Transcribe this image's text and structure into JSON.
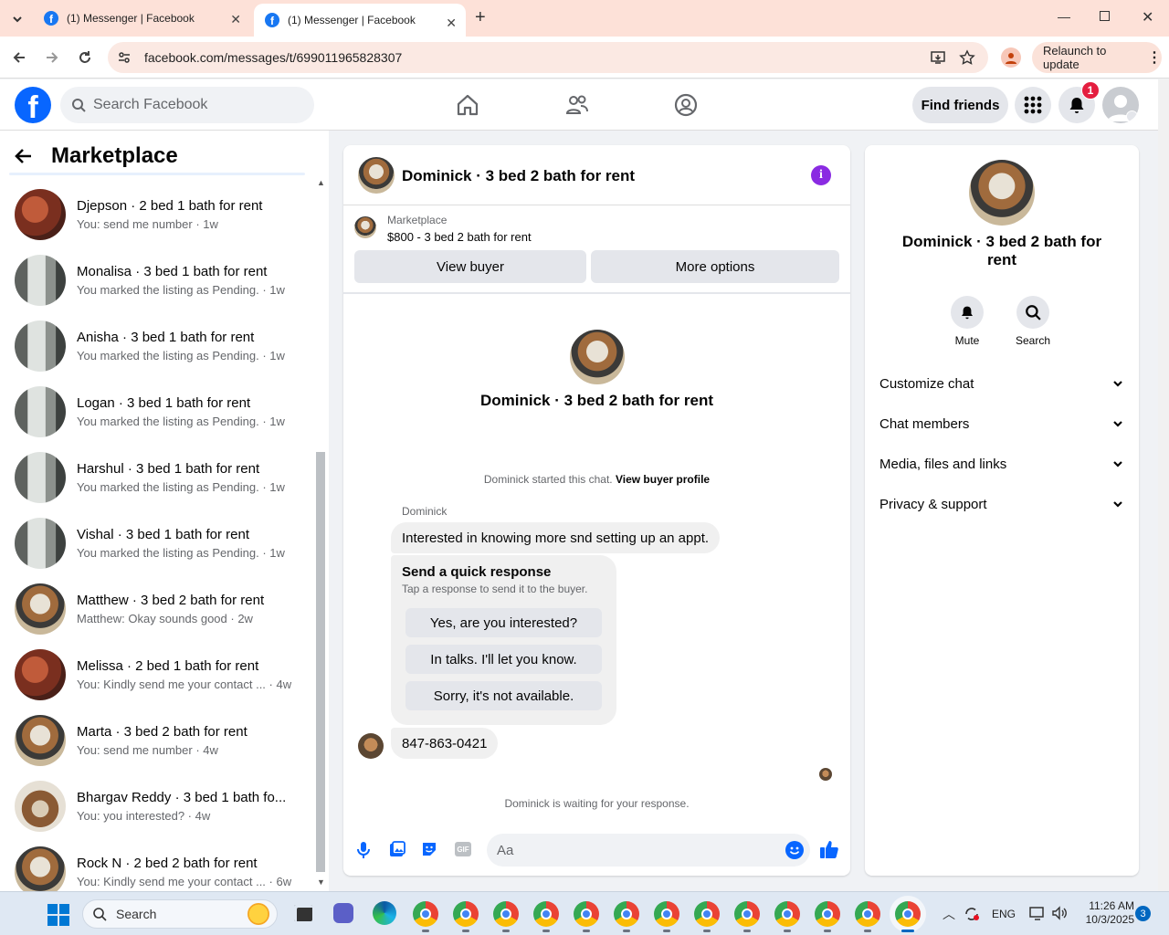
{
  "browser": {
    "tabs": [
      {
        "title": "(1) Messenger | Facebook"
      },
      {
        "title": "(1) Messenger | Facebook"
      }
    ],
    "url": "facebook.com/messages/t/699011965828307",
    "relaunch_label": "Relaunch to update"
  },
  "fb": {
    "search_placeholder": "Search Facebook",
    "find_friends": "Find friends",
    "notif_count": "1"
  },
  "left": {
    "title": "Marketplace",
    "conversations": [
      {
        "name": "Djepson · 2 bed 1 bath for rent",
        "preview": "You: send me number · 1w",
        "avatar": "red"
      },
      {
        "name": "Monalisa · 3 bed 1 bath for rent",
        "preview": "You marked the listing as Pending. · 1w",
        "avatar": "gray"
      },
      {
        "name": "Anisha · 3 bed 1 bath for rent",
        "preview": "You marked the listing as Pending. · 1w",
        "avatar": "gray"
      },
      {
        "name": "Logan · 3 bed 1 bath for rent",
        "preview": "You marked the listing as Pending. · 1w",
        "avatar": "gray"
      },
      {
        "name": "Harshul · 3 bed 1 bath for rent",
        "preview": "You marked the listing as Pending. · 1w",
        "avatar": "gray"
      },
      {
        "name": "Vishal · 3 bed 1 bath for rent",
        "preview": "You marked the listing as Pending. · 1w",
        "avatar": "gray"
      },
      {
        "name": "Matthew · 3 bed 2 bath for rent",
        "preview": "Matthew: Okay sounds good · 2w",
        "avatar": "room"
      },
      {
        "name": "Melissa · 2 bed 1 bath for rent",
        "preview": "You: Kindly send me your contact ... · 4w",
        "avatar": "red"
      },
      {
        "name": "Marta · 3 bed 2 bath for rent",
        "preview": "You: send me number · 4w",
        "avatar": "room"
      },
      {
        "name": "Bhargav Reddy · 3 bed 1 bath fo...",
        "preview": "You: you interested? · 4w",
        "avatar": "kitchen"
      },
      {
        "name": "Rock N · 2 bed 2 bath for rent",
        "preview": "You: Kindly send me your contact ... · 6w",
        "avatar": "room"
      }
    ]
  },
  "chat": {
    "header_title": "Dominick · 3 bed 2 bath for rent",
    "listing_source": "Marketplace",
    "listing_text": "$800 - 3 bed 2 bath for rent",
    "view_buyer": "View buyer",
    "more_options": "More options",
    "profile_name": "Dominick · 3 bed 2 bath for rent",
    "started_text": "Dominick started this chat.",
    "view_buyer_profile": "View buyer profile",
    "sender_name": "Dominick",
    "message1": "Interested in knowing more snd setting up an appt.",
    "quick_title": "Send a quick response",
    "quick_sub": "Tap a response to send it to the buyer.",
    "quick_options": [
      "Yes, are you interested?",
      "In talks. I'll let you know.",
      "Sorry, it's not available."
    ],
    "message2": "847-863-0421",
    "waiting": "Dominick is waiting for your response.",
    "composer_placeholder": "Aa"
  },
  "info": {
    "name": "Dominick · 3 bed 2 bath for rent",
    "mute": "Mute",
    "search": "Search",
    "sections": [
      "Customize chat",
      "Chat members",
      "Media, files and links",
      "Privacy & support"
    ]
  },
  "taskbar": {
    "search": "Search",
    "lang": "ENG",
    "time": "11:26 AM",
    "date": "10/3/2025",
    "notif_count": "3"
  },
  "colors": {
    "accent": "#0866ff",
    "info_purple": "#8a2be2",
    "bg": "#f0f2f5"
  }
}
